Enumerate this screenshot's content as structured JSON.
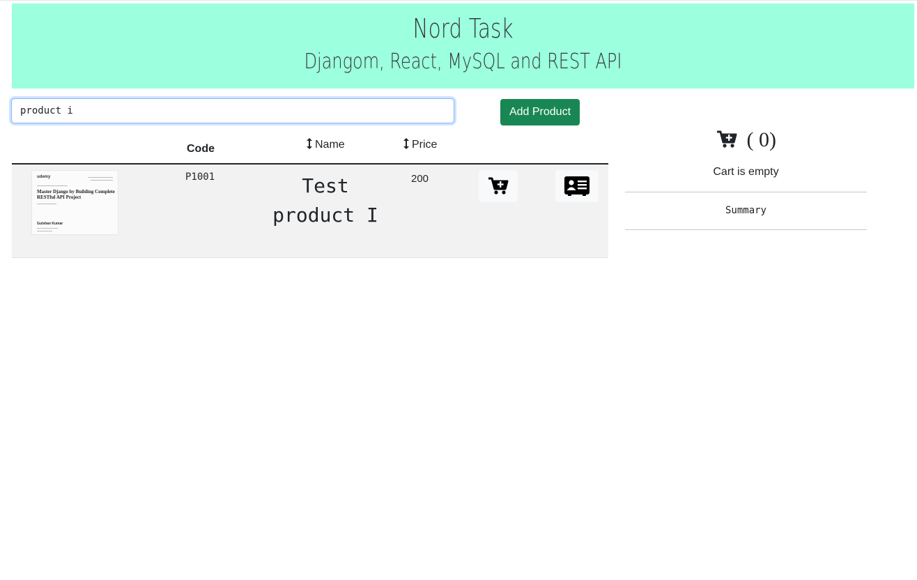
{
  "header": {
    "title": "Nord Task",
    "subtitle": "Djangom, React, MySQL and REST API",
    "background": "#9cffdd"
  },
  "search": {
    "value": "product i"
  },
  "toolbar": {
    "add_product_label": "Add Product",
    "accent": "#198754"
  },
  "table": {
    "columns": [
      "Code",
      "Name",
      "Price"
    ],
    "rows": [
      {
        "thumbnail": {
          "brand": "udemy",
          "title": "Master Django by Building Complete RESTful API Project",
          "name": "Gulshan Kumar"
        },
        "code": "P1001",
        "name": "Test product I",
        "price": "200",
        "icons": [
          "cart-plus-icon",
          "contact-card-icon"
        ]
      }
    ]
  },
  "cart": {
    "count_label": "( 0)",
    "empty_text": "Cart is empty",
    "summary_label": "Summary",
    "icon": "cart-plus-icon"
  }
}
